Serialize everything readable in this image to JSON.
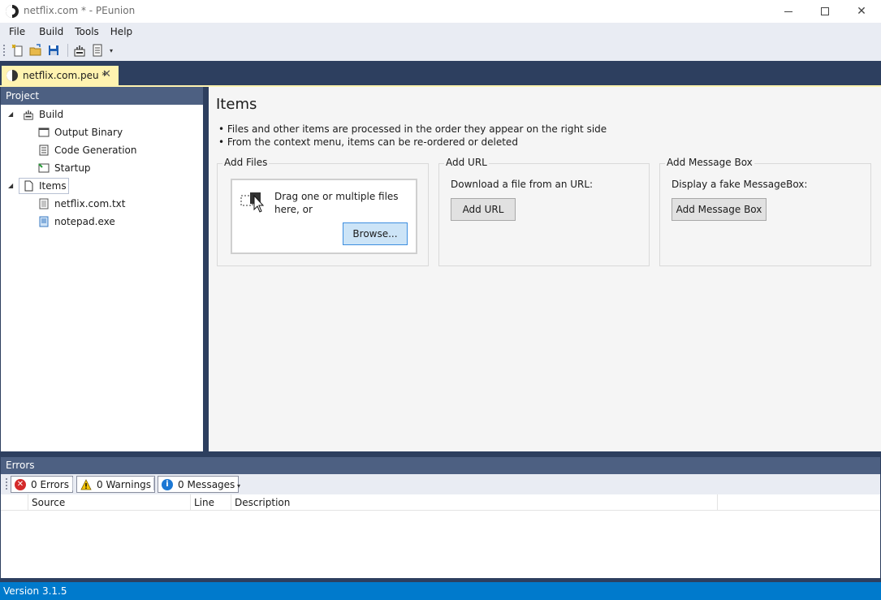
{
  "window": {
    "title": "netflix.com * - PEunion"
  },
  "menu": {
    "items": [
      "File",
      "Build",
      "Tools",
      "Help"
    ]
  },
  "toolbar": {
    "buttons": [
      "new-file-icon",
      "open-folder-icon",
      "save-icon",
      "build-icon",
      "code-file-icon"
    ]
  },
  "tabs": {
    "active_label": "netflix.com.peu *",
    "close_glyph": "✕"
  },
  "project": {
    "header": "Project",
    "tree": {
      "build": "Build",
      "output_binary": "Output Binary",
      "code_generation": "Code Generation",
      "startup": "Startup",
      "items": "Items",
      "file1": "netflix.com.txt",
      "file2": "notepad.exe"
    }
  },
  "main": {
    "title": "Items",
    "bullets": [
      "• Files and other items are processed in the order they appear on the right side",
      "• From the context menu, items can be re-ordered or deleted"
    ],
    "add_files": {
      "title": "Add Files",
      "drop_text": "Drag one or multiple files here, or",
      "browse_label": "Browse..."
    },
    "add_url": {
      "title": "Add URL",
      "text": "Download a file from an URL:",
      "button_label": "Add URL"
    },
    "add_message_box": {
      "title": "Add Message Box",
      "text": "Display a fake MessageBox:",
      "button_label": "Add Message Box"
    }
  },
  "errors": {
    "header": "Errors",
    "filters": {
      "errors": "0 Errors",
      "warnings": "0 Warnings",
      "messages": "0 Messages"
    },
    "columns": [
      "Source",
      "Line",
      "Description"
    ]
  },
  "status": {
    "version": "Version 3.1.5"
  },
  "colors": {
    "accent": "#2d3f5f",
    "tab_active": "#fff3b0",
    "status_bar": "#007acc",
    "primary_button": "#cce4f7"
  }
}
